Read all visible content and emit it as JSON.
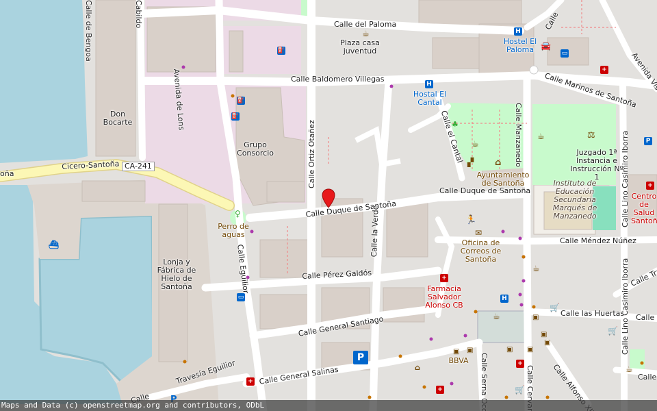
{
  "map": {
    "streets": {
      "calle_del_paloma": "Calle del Paloma",
      "calle_baldomero": "Calle Baldomero Villegas",
      "avenida_lons": "Avenida de Lons",
      "calle_ortiz": "Calle Ortiz Otañez",
      "calle_duque_w": "Calle Duque de Santoña",
      "calle_duque_e": "Calle Duque de Santoña",
      "calle_verde": "Calle la Verde",
      "calle_cantal": "Calle el Cantal",
      "calle_manzanedo": "Calle Manzanedo",
      "calle_marinos": "Calle Marinos de Santoña",
      "avenida_vis": "Avenida Vis",
      "calle_lino": "Calle Lino Casimiro Iborra",
      "calle_lino_s": "Calle Lino Casimiro Iborra",
      "calle_mendez": "Calle Méndez Núñez",
      "calle_perez": "Calle Pérez Galdós",
      "calle_general_santiago": "Calle General Santiago",
      "calle_general_salinas": "Calle General Salinas",
      "calle_equilior": "Calle Eguilior",
      "travesia_equilior": "Travesía Eguilior",
      "calle_huertas": "Calle las Huertas",
      "calle_huertas_e": "Calle M",
      "calle_tra": "Calle Tra",
      "calle_alfonso": "Calle Alfonso XII",
      "calle_serna": "Calle Serna Occina",
      "calle_cervantes": "Calle Cervan",
      "calle_bengoa": "Calle de Bengoa",
      "cabildo": "Cabildo",
      "cicero": "Cicero-Santoña",
      "cicero_left": "oña",
      "ca241": "CA-241",
      "calle_ma": "Calle Ma",
      "calle_ne": "Calle",
      "calle_e_bottom": "Calle"
    },
    "pois": {
      "plaza_casa": "Plaza casa juventud",
      "hostel_paloma": "Hostel El Paloma",
      "hostal_cantal": "Hostal El Cantal",
      "don_bocarte": "Don Bocarte",
      "grupo_consorcio": "Grupo Consorcio",
      "perro_aguas": "Perro de aguas",
      "lonja": "Lonja y Fábrica de Hielo de Santoña",
      "ayuntamiento": "Ayuntamiento de Santoña",
      "juzgado": "Juzgado 1ª Instancia e Instrucción Nº 1",
      "instituto": "Instituto de Educación Secundaria Marqués de Manzanedo",
      "oficina_correos": "Oficina de Correos de Santoña",
      "farmacia": "Farmacia Salvador Alonso CB",
      "bbva": "BBVA",
      "centro_salud": "Centro de Salud Santoña"
    },
    "icons": {
      "marker": "map-marker-icon",
      "fuel": "fuel-station-icon",
      "parking": "parking-icon",
      "bus": "bus-stop-icon",
      "pharmacy": "pharmacy-icon",
      "post": "post-office-icon",
      "bank": "bank-icon",
      "hotel": "hotel-icon",
      "cafe": "cafe-icon",
      "shop": "shopping-cart-icon",
      "ferry": "ferry-icon",
      "townhall": "townhall-icon",
      "courthouse": "courthouse-icon",
      "fitness": "fitness-icon",
      "playground": "playground-icon"
    },
    "colors": {
      "water": "#aad3df",
      "land": "#e3e1de",
      "building": "#d9d0c9",
      "residential_pink": "#ecdae6",
      "park": "#c8facc",
      "primary_road": "#fcf7b5",
      "marker": "#e8191b"
    }
  },
  "footer": {
    "attribution": "Maps and Data (c) openstreetmap.org and contributors, ODbL"
  }
}
